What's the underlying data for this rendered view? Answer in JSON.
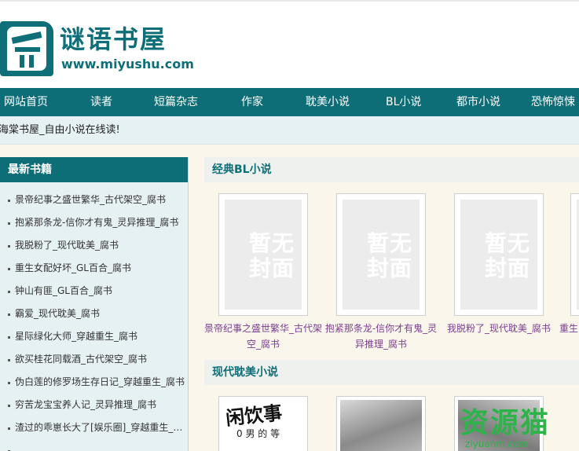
{
  "site": {
    "title": "谜语书屋",
    "url": "www.miyushu.com"
  },
  "nav": {
    "items": [
      "网站首页",
      "读者",
      "短篇杂志",
      "作家",
      "耽美小说",
      "BL小说",
      "都市小说",
      "恐怖惊悚"
    ]
  },
  "notice": "海棠书屋_自由小说在线读!",
  "sidebar": {
    "title": "最新书籍",
    "items": [
      "景帝纪事之盛世繁华_古代架空_腐书",
      "抱紧那条龙-信你才有鬼_灵异推理_腐书",
      "我脱粉了_现代耽美_腐书",
      "重生女配好坏_GL百合_腐书",
      "钟山有匪_GL百合_腐书",
      "霸爱_现代耽美_腐书",
      "星际绿化大师_穿越重生_腐书",
      "欲买桂花同载酒_古代架空_腐书",
      "伪白莲的修罗场生存日记_穿越重生_腐书",
      "穷苦龙宝宝养人记_灵异推理_腐书",
      "渣过的乖崽长大了[娱乐圈]_穿越重生_腐书",
      ""
    ]
  },
  "sections": {
    "classic_bl": {
      "title": "经典BL小说",
      "placeholder_text": "暂无封面",
      "books": [
        "景帝纪事之盛世繁华_古代架空_腐书",
        "抱紧那条龙-信你才有鬼_灵异推理_腐书",
        "我脱粉了_现代耽美_腐书",
        "重生"
      ]
    },
    "modern_bl": {
      "title": "现代耽美小说",
      "cover1_text": "闲饮事",
      "cover1_small": "0 男 的 等"
    }
  },
  "watermark": {
    "text": "资源猫",
    "url": "ziyuanm.com"
  },
  "colors": {
    "brand": "#0e6e77",
    "book_title": "#7a3e8f",
    "watermark": "#2db34a"
  }
}
